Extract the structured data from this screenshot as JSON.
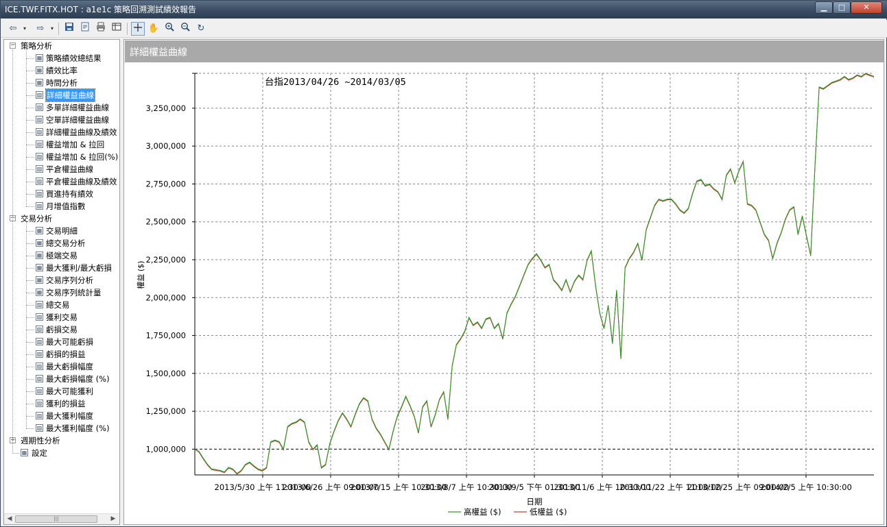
{
  "window": {
    "title": "ICE.TWF.FITX.HOT : a1e1c 策略回溯測試績效報告",
    "minimize_glyph": "▁",
    "maximize_glyph": "□",
    "close_glyph": "✕"
  },
  "toolbar": {
    "icons": [
      "back-arrow-icon",
      "dropdown-icon",
      "forward-arrow-icon",
      "dropdown-icon",
      "save-icon",
      "export-icon",
      "print-icon",
      "table-icon",
      "crosshair-icon",
      "pan-hand-icon",
      "zoom-in-icon",
      "zoom-out-icon",
      "reset-zoom-icon"
    ]
  },
  "tree": {
    "groups": [
      {
        "label": "策略分析",
        "items": [
          "策略績效總結果",
          "績效比率",
          "時間分析",
          "詳細權益曲線",
          "多單詳細權益曲線",
          "空單詳細權益曲線",
          "詳細權益曲線及績效",
          "權益增加 & 拉回",
          "權益增加 & 拉回(%)",
          "平倉權益曲線",
          "平倉權益曲線及績效",
          "買進持有績效",
          "月增值指數"
        ]
      },
      {
        "label": "交易分析",
        "items": [
          "交易明細",
          "總交易分析",
          "極端交易",
          "最大獲利/最大虧損",
          "交易序列分析",
          "交易序列統計量",
          "總交易",
          "獲利交易",
          "虧損交易",
          "最大可能虧損",
          "虧損的損益",
          "最大虧損幅度",
          "最大虧損幅度 (%)",
          "最大可能獲利",
          "獲利的損益",
          "最大獲利幅度",
          "最大獲利幅度 (%)"
        ]
      },
      {
        "label": "週期性分析",
        "items": []
      },
      {
        "label": "設定",
        "items": []
      }
    ],
    "selected": "詳細權益曲線"
  },
  "content": {
    "header": "詳細權益曲線"
  },
  "chart_data": {
    "type": "line",
    "title": "台指2013/04/26 ~2014/03/05",
    "xlabel": "日期",
    "ylabel": "權益 ($)",
    "ylim": [
      830000,
      3480000
    ],
    "yticks": [
      "1,000,000",
      "1,250,000",
      "1,500,000",
      "1,750,000",
      "2,000,000",
      "2,250,000",
      "2,500,000",
      "2,750,000",
      "3,000,000",
      "3,250,000"
    ],
    "xticks": [
      "2013/5/30 上午 11:30:00",
      "2013/6/26 上午 09:00:00",
      "2013/7/15 上午 10:30:00",
      "2013/8/7 上午 10:30:00",
      "2013/9/5 下午 01:30:00",
      "2013/11/6 上午 10:30:00",
      "2013/11/22 上午 11:00:00",
      "2013/12/25 上午 09:00:00",
      "2014/2/5 上午 10:30:00"
    ],
    "legend_position": "bottom-center",
    "series": [
      {
        "name": "高權益 ($)",
        "color": "#2e9a2e",
        "values": [
          1000000,
          985000,
          940000,
          900000,
          870000,
          865000,
          860000,
          850000,
          880000,
          870000,
          840000,
          860000,
          900000,
          915000,
          890000,
          870000,
          860000,
          880000,
          1050000,
          1060000,
          1050000,
          1000000,
          1150000,
          1170000,
          1180000,
          1200000,
          1180000,
          1050000,
          1000000,
          1030000,
          880000,
          900000,
          1040000,
          1120000,
          1190000,
          1240000,
          1200000,
          1150000,
          1230000,
          1300000,
          1340000,
          1320000,
          1200000,
          1140000,
          1100000,
          1050000,
          1000000,
          1120000,
          1220000,
          1280000,
          1350000,
          1290000,
          1220000,
          1110000,
          1280000,
          1320000,
          1150000,
          1230000,
          1330000,
          1380000,
          1200000,
          1550000,
          1690000,
          1730000,
          1780000,
          1870000,
          1820000,
          1840000,
          1800000,
          1860000,
          1870000,
          1800000,
          1830000,
          1730000,
          1900000,
          1960000,
          2010000,
          2080000,
          2150000,
          2220000,
          2260000,
          2290000,
          2250000,
          2200000,
          2220000,
          2120000,
          2090000,
          2050000,
          2120000,
          2040000,
          2110000,
          2150000,
          2120000,
          2250000,
          2310000,
          2080000,
          1900000,
          1800000,
          1950000,
          1700000,
          2050000,
          1600000,
          2200000,
          2260000,
          2300000,
          2360000,
          2250000,
          2450000,
          2530000,
          2610000,
          2650000,
          2640000,
          2650000,
          2650000,
          2620000,
          2580000,
          2560000,
          2590000,
          2690000,
          2770000,
          2780000,
          2740000,
          2750000,
          2720000,
          2700000,
          2650000,
          2810000,
          2850000,
          2760000,
          2840000,
          2900000,
          2620000,
          2610000,
          2580000,
          2500000,
          2420000,
          2380000,
          2260000,
          2360000,
          2430000,
          2520000,
          2580000,
          2600000,
          2420000,
          2540000,
          2410000,
          2280000,
          2860000,
          3390000,
          3380000,
          3400000,
          3420000,
          3430000,
          3440000,
          3460000,
          3440000,
          3450000,
          3470000,
          3460000,
          3480000,
          3470000,
          3460000
        ]
      },
      {
        "name": "低權益 ($)",
        "color": "#c8382a",
        "values": [
          1000000,
          980000,
          935000,
          895000,
          865000,
          860000,
          855000,
          845000,
          875000,
          865000,
          835000,
          855000,
          895000,
          910000,
          885000,
          865000,
          855000,
          875000,
          1045000,
          1055000,
          1045000,
          995000,
          1145000,
          1165000,
          1175000,
          1195000,
          1175000,
          1045000,
          995000,
          1025000,
          875000,
          895000,
          1035000,
          1115000,
          1185000,
          1235000,
          1195000,
          1145000,
          1225000,
          1295000,
          1335000,
          1315000,
          1195000,
          1135000,
          1095000,
          1045000,
          995000,
          1115000,
          1215000,
          1275000,
          1345000,
          1285000,
          1215000,
          1105000,
          1275000,
          1315000,
          1145000,
          1225000,
          1325000,
          1375000,
          1195000,
          1545000,
          1685000,
          1725000,
          1775000,
          1865000,
          1815000,
          1835000,
          1795000,
          1855000,
          1865000,
          1795000,
          1825000,
          1725000,
          1895000,
          1955000,
          2005000,
          2075000,
          2145000,
          2215000,
          2255000,
          2285000,
          2245000,
          2195000,
          2215000,
          2115000,
          2085000,
          2045000,
          2115000,
          2035000,
          2105000,
          2145000,
          2115000,
          2245000,
          2305000,
          2075000,
          1895000,
          1795000,
          1945000,
          1695000,
          2045000,
          1595000,
          2195000,
          2255000,
          2295000,
          2355000,
          2245000,
          2445000,
          2525000,
          2605000,
          2645000,
          2635000,
          2645000,
          2645000,
          2615000,
          2575000,
          2555000,
          2585000,
          2685000,
          2765000,
          2775000,
          2735000,
          2745000,
          2715000,
          2695000,
          2645000,
          2805000,
          2845000,
          2755000,
          2835000,
          2895000,
          2615000,
          2605000,
          2575000,
          2495000,
          2415000,
          2375000,
          2255000,
          2355000,
          2425000,
          2515000,
          2575000,
          2595000,
          2415000,
          2535000,
          2405000,
          2275000,
          2855000,
          3385000,
          3375000,
          3395000,
          3415000,
          3425000,
          3435000,
          3455000,
          3435000,
          3445000,
          3465000,
          3455000,
          3475000,
          3465000,
          3455000
        ]
      }
    ]
  }
}
